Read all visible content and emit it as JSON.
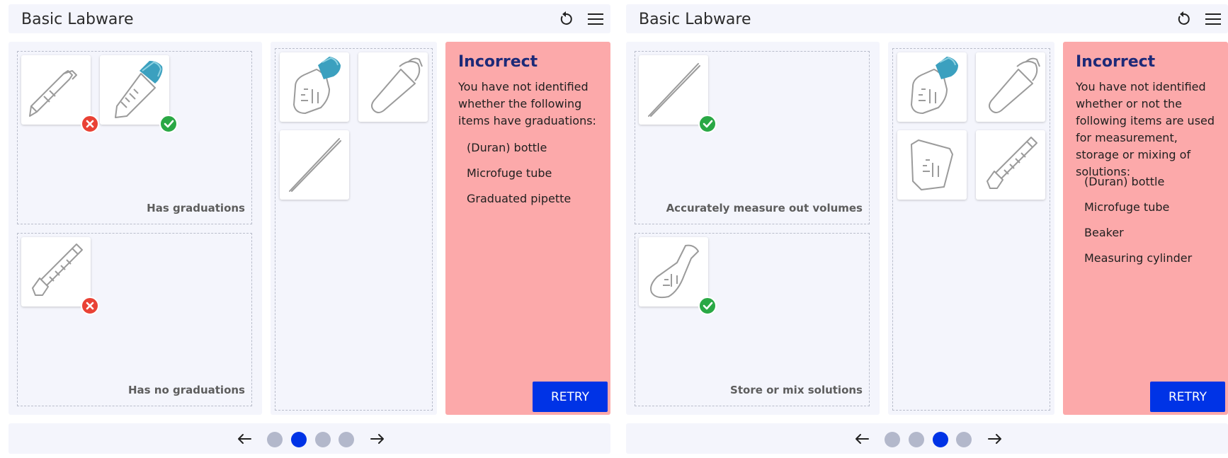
{
  "colors": {
    "accent": "#0033e6",
    "correct": "#2aa845",
    "incorrect": "#e94235",
    "feedback_bg": "#fca9aa",
    "bottle_cap": "#3ba0bf"
  },
  "panels": [
    {
      "header": {
        "title": "Basic Labware"
      },
      "zones": [
        {
          "label": "Has graduations"
        },
        {
          "label": "Has no graduations"
        }
      ],
      "feedback": {
        "title": "Incorrect",
        "message": "You have not identified whether the following items have graduations:",
        "items": [
          "(Duran) bottle",
          "Microfuge tube",
          "Graduated pipette"
        ],
        "retry_label": "RETRY"
      },
      "pagination": {
        "pages": 4,
        "current": 2
      }
    },
    {
      "header": {
        "title": "Basic Labware"
      },
      "zones": [
        {
          "label": "Accurately measure out volumes"
        },
        {
          "label": "Store or mix solutions"
        }
      ],
      "feedback": {
        "title": "Incorrect",
        "message": "You have not identified whether or not the following items are used for measurement, storage or mixing of solutions:",
        "items": [
          "(Duran) bottle",
          "Microfuge tube",
          "Beaker",
          "Measuring cylinder"
        ],
        "retry_label": "RETRY"
      },
      "pagination": {
        "pages": 4,
        "current": 3
      }
    }
  ],
  "icons": {
    "header": [
      "reset-icon",
      "hamburger-menu-icon"
    ],
    "footer": [
      "arrow-left-icon",
      "arrow-right-icon"
    ],
    "labware": [
      "pipette-tip-icon",
      "conical-tube-icon",
      "duran-bottle-icon",
      "microfuge-tube-icon",
      "graduated-pipette-icon",
      "measuring-cylinder-icon",
      "beaker-icon",
      "conical-flask-icon"
    ],
    "badges": [
      "check-icon",
      "cross-icon"
    ]
  }
}
